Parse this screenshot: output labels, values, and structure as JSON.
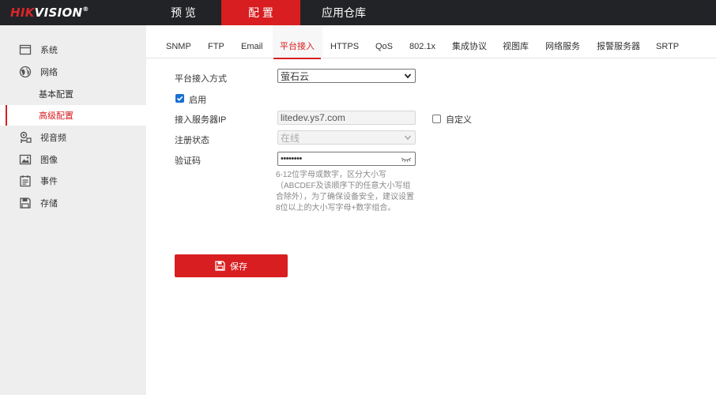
{
  "brand": {
    "part1": "HIK",
    "part2": "VISION",
    "reg": "®"
  },
  "top_nav": [
    {
      "label": "预 览"
    },
    {
      "label": "配 置"
    },
    {
      "label": "应用仓库"
    }
  ],
  "sidebar": {
    "items": [
      {
        "label": "系统",
        "icon": "monitor-icon"
      },
      {
        "label": "网络",
        "icon": "globe-icon"
      },
      {
        "label": "基本配置"
      },
      {
        "label": "高级配置"
      },
      {
        "label": "视音频",
        "icon": "audio-video-icon"
      },
      {
        "label": "图像",
        "icon": "image-icon"
      },
      {
        "label": "事件",
        "icon": "event-calendar-icon"
      },
      {
        "label": "存储",
        "icon": "storage-icon"
      }
    ]
  },
  "tabs": [
    "SNMP",
    "FTP",
    "Email",
    "平台接入",
    "HTTPS",
    "QoS",
    "802.1x",
    "集成协议",
    "视图库",
    "网络服务",
    "报警服务器",
    "SRTP"
  ],
  "form": {
    "platform_mode_label": "平台接入方式",
    "platform_mode_value": "萤石云",
    "enable_label": "启用",
    "server_ip_label": "接入服务器IP",
    "server_ip_value": "litedev.ys7.com",
    "custom_label": "自定义",
    "register_status_label": "注册状态",
    "register_status_value": "在线",
    "verify_code_label": "验证码",
    "verify_code_value": "••••••••",
    "hint": "6-12位字母或数字，区分大小写（ABCDEF及该顺序下的任意大小写组合除外），为了确保设备安全，建议设置8位以上的大小写字母+数字组合。"
  },
  "save_button": {
    "label": "保存"
  },
  "colors": {
    "accent": "#d81e20",
    "topbar": "#222326",
    "sidebar": "#eeeeee"
  }
}
